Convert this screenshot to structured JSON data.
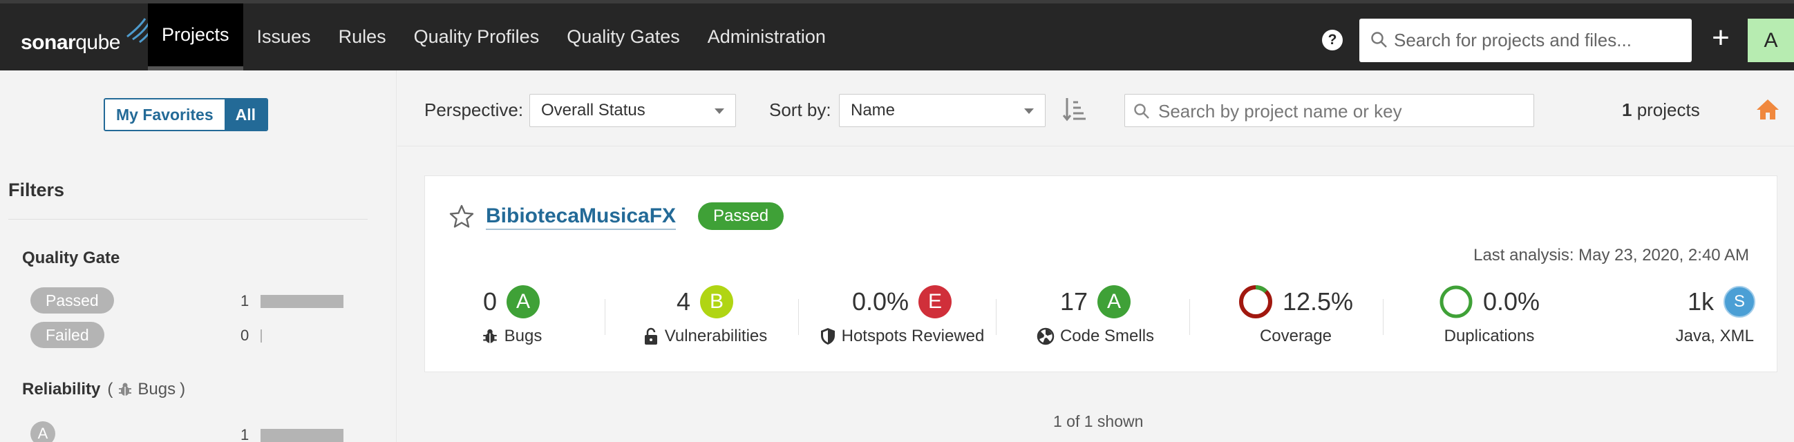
{
  "topbar": {
    "logo_bold": "sonar",
    "logo_light": "qube",
    "nav": [
      "Projects",
      "Issues",
      "Rules",
      "Quality Profiles",
      "Quality Gates",
      "Administration"
    ],
    "active_nav": "Projects",
    "help_label": "?",
    "search_placeholder": "Search for projects and files...",
    "plus_label": "+",
    "avatar_letter": "A"
  },
  "sidebar": {
    "fav_my": "My Favorites",
    "fav_all": "All",
    "filters_title": "Filters",
    "quality_gate": {
      "title": "Quality Gate",
      "items": [
        {
          "label": "Passed",
          "count": "1",
          "bar_fraction": 1.0
        },
        {
          "label": "Failed",
          "count": "0",
          "bar_fraction": 0.0
        }
      ]
    },
    "reliability": {
      "title": "Reliability",
      "paren_open": "(",
      "sub_label": "Bugs",
      "paren_close": ")",
      "items": [
        {
          "label": "A",
          "count": "1",
          "bar_fraction": 1.0
        }
      ]
    }
  },
  "toolbar": {
    "perspective_label": "Perspective:",
    "perspective_value": "Overall Status",
    "sort_label": "Sort by:",
    "sort_value": "Name",
    "search_placeholder": "Search by project name or key",
    "count_number": "1",
    "count_suffix": " projects"
  },
  "project": {
    "name": "BibiotecaMusicaFX",
    "status": "Passed",
    "last_analysis": "Last analysis: May 23, 2020, 2:40 AM",
    "measures": {
      "bugs": {
        "value": "0",
        "rating": "A",
        "label": "Bugs"
      },
      "vulnerabilities": {
        "value": "4",
        "rating": "B",
        "label": "Vulnerabilities"
      },
      "hotspots": {
        "value": "0.0%",
        "rating": "E",
        "label": "Hotspots Reviewed"
      },
      "code_smells": {
        "value": "17",
        "rating": "A",
        "label": "Code Smells"
      },
      "coverage": {
        "value": "12.5%",
        "percent": 12.5,
        "label": "Coverage"
      },
      "duplications": {
        "value": "0.0%",
        "percent": 0.0,
        "label": "Duplications"
      },
      "size": {
        "value": "1k",
        "size_rating": "S",
        "label": "Java, XML"
      }
    }
  },
  "footer": {
    "shown": "1 of 1 shown"
  },
  "colors": {
    "rating_A": "#3fa137",
    "rating_B": "#b0d513",
    "rating_E": "#d02f3a",
    "size_S": "#4b9fd5",
    "link": "#236a97",
    "coverage_fill": "#3fa137",
    "coverage_rest": "#a1180f"
  }
}
